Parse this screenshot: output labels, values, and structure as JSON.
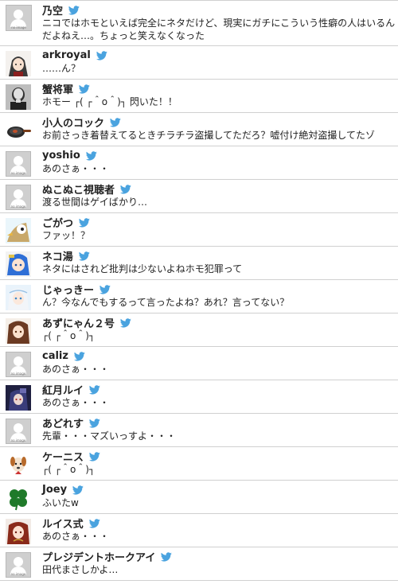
{
  "avatar_placeholder_caption": "no image",
  "tweets": [
    {
      "name": "乃空",
      "text": "ニコではホモといえば完全にネタだけど、現実にガチにこういう性癖の人はいるんだよねえ…。ちょっと笑えなくなった",
      "avatar": "no-image"
    },
    {
      "name": "arkroyal",
      "text": "……ん？",
      "avatar": "anime-character"
    },
    {
      "name": "蟹将軍",
      "text": "ホモー ┌( ┌＾o＾)┐ 閃いた！！",
      "avatar": "bald-man"
    },
    {
      "name": "小人のコック",
      "text": "お前さっき着替えてるときチラチラ盗撮してただろ？嘘付け絶対盗撮してたゾ",
      "avatar": "frying-pan"
    },
    {
      "name": "yoshio",
      "text": "あのさぁ・・・",
      "avatar": "no-image"
    },
    {
      "name": "ぬこぬこ視聴者",
      "text": "渡る世間はゲイばかり…",
      "avatar": "no-image"
    },
    {
      "name": "ごがつ",
      "text": "ファッ！？",
      "avatar": "cartoon-bird"
    },
    {
      "name": "ネコ湯",
      "text": "ネタにはされど批判は少ないよねホモ犯罪って",
      "avatar": "anime-blue-hair"
    },
    {
      "name": "じゃっきー",
      "text": "ん？今なんでもするって言ったよね？あれ？言ってない？",
      "avatar": "anime-white-hair"
    },
    {
      "name": "あずにゃん２号",
      "text": "┌( ┌＾o＾)┐",
      "avatar": "anime-brown-hair"
    },
    {
      "name": "caliz",
      "text": "あのさぁ・・・",
      "avatar": "no-image"
    },
    {
      "name": "紅月ルイ",
      "text": "あのさぁ・・・",
      "avatar": "anime-dark"
    },
    {
      "name": "あどれす",
      "text": "先輩・・・マズいっすよ・・・",
      "avatar": "no-image"
    },
    {
      "name": "ケーニス",
      "text": "┌( ┌＾o＾)┐",
      "avatar": "cartoon-dog"
    },
    {
      "name": "Joey",
      "text": "ふいたw",
      "avatar": "clover"
    },
    {
      "name": "ルイス式",
      "text": "あのさぁ・・・",
      "avatar": "anime-red"
    },
    {
      "name": "プレジデントホークアイ",
      "text": "田代まさしかよ…",
      "avatar": "no-image"
    }
  ],
  "colors": {
    "twitter_bird": "#4aa3df",
    "divider": "#d0d0d0",
    "text": "#222222"
  }
}
